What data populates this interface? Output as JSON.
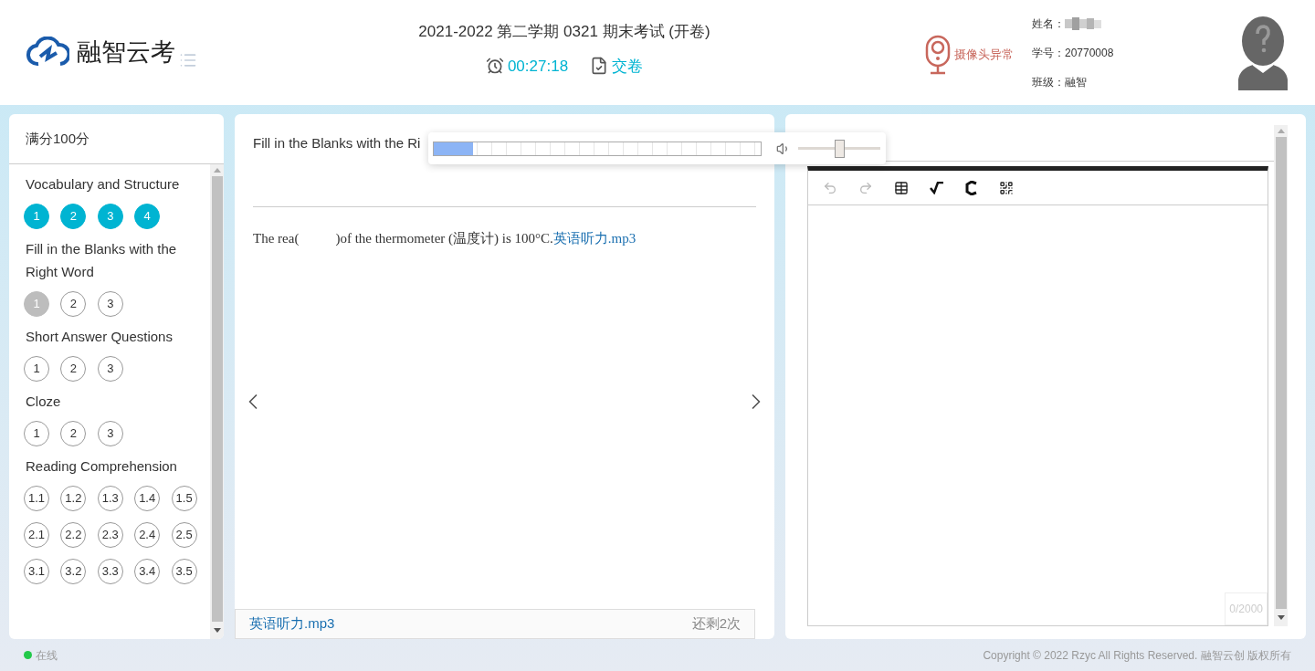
{
  "header": {
    "logo_text": "融智云考",
    "exam_title": "2021-2022 第二学期 0321 期末考试 (开卷)",
    "timer": "00:27:18",
    "submit": "交卷",
    "camera_status": "摄像头异常",
    "student": [
      {
        "label": "姓名：",
        "kind": "blurred"
      },
      {
        "label": "学号：",
        "value": "20770008",
        "kind": "text"
      },
      {
        "label": "班级：",
        "value": "融智",
        "kind": "text"
      }
    ]
  },
  "nav": {
    "score": "满分100分",
    "sections": [
      {
        "title": "Vocabulary and Structure",
        "questions": [
          {
            "label": "1",
            "answered": true,
            "selected": false
          },
          {
            "label": "2",
            "answered": true,
            "selected": false
          },
          {
            "label": "3",
            "answered": true,
            "selected": false
          },
          {
            "label": "4",
            "answered": true,
            "selected": false
          }
        ]
      },
      {
        "title": "Fill in the Blanks with the Right Word",
        "questions": [
          {
            "label": "1",
            "answered": false,
            "selected": true
          },
          {
            "label": "2",
            "answered": false,
            "selected": false
          },
          {
            "label": "3",
            "answered": false,
            "selected": false
          }
        ]
      },
      {
        "title": "Short Answer Questions",
        "questions": [
          {
            "label": "1",
            "answered": false,
            "selected": false
          },
          {
            "label": "2",
            "answered": false,
            "selected": false
          },
          {
            "label": "3",
            "answered": false,
            "selected": false
          }
        ]
      },
      {
        "title": "Cloze",
        "questions": [
          {
            "label": "1",
            "answered": false,
            "selected": false
          },
          {
            "label": "2",
            "answered": false,
            "selected": false
          },
          {
            "label": "3",
            "answered": false,
            "selected": false
          }
        ]
      },
      {
        "title": "Reading Comprehension",
        "questions": [
          {
            "label": "1.1",
            "answered": false,
            "selected": false
          },
          {
            "label": "1.2",
            "answered": false,
            "selected": false
          },
          {
            "label": "1.3",
            "answered": false,
            "selected": false
          },
          {
            "label": "1.4",
            "answered": false,
            "selected": false
          },
          {
            "label": "1.5",
            "answered": false,
            "selected": false
          },
          {
            "label": "2.1",
            "answered": false,
            "selected": false
          },
          {
            "label": "2.2",
            "answered": false,
            "selected": false
          },
          {
            "label": "2.3",
            "answered": false,
            "selected": false
          },
          {
            "label": "2.4",
            "answered": false,
            "selected": false
          },
          {
            "label": "2.5",
            "answered": false,
            "selected": false
          },
          {
            "label": "3.1",
            "answered": false,
            "selected": false
          },
          {
            "label": "3.2",
            "answered": false,
            "selected": false
          },
          {
            "label": "3.3",
            "answered": false,
            "selected": false
          },
          {
            "label": "3.4",
            "answered": false,
            "selected": false
          },
          {
            "label": "3.5",
            "answered": false,
            "selected": false
          }
        ]
      }
    ]
  },
  "question": {
    "section_title": "Fill in the Blanks with the Ri",
    "text_before": "The rea(",
    "text_after": ")of the thermometer (温度计) is 100°C.",
    "attachment": "英语听力.mp3",
    "audio_file": "英语听力.mp3",
    "plays_left": "还剩2次"
  },
  "player": {
    "progress": {
      "level": 0.12
    },
    "volume": {
      "level": 0.5
    }
  },
  "editor": {
    "counter": "0/2000"
  },
  "footer": {
    "status": "在线",
    "online": true,
    "copyright": "Copyright © 2022 Rzyc All Rights Reserved. 融智云创 版权所有"
  }
}
